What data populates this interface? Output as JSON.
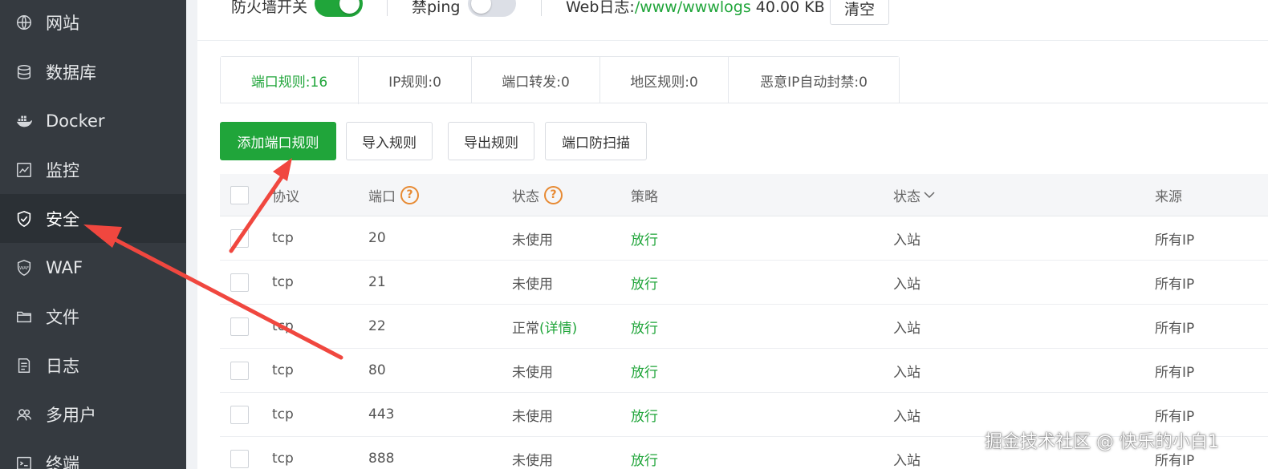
{
  "sidebar": {
    "items": [
      {
        "label": "网站",
        "icon": "globe-icon"
      },
      {
        "label": "数据库",
        "icon": "database-icon"
      },
      {
        "label": "Docker",
        "icon": "docker-icon"
      },
      {
        "label": "监控",
        "icon": "monitor-icon"
      },
      {
        "label": "安全",
        "icon": "shield-icon",
        "active": true
      },
      {
        "label": "WAF",
        "icon": "waf-shield-icon"
      },
      {
        "label": "文件",
        "icon": "folder-icon"
      },
      {
        "label": "日志",
        "icon": "log-icon"
      },
      {
        "label": "多用户",
        "icon": "users-icon"
      },
      {
        "label": "终端",
        "icon": "terminal-icon"
      }
    ]
  },
  "topbar": {
    "firewall_label": "防火墙开关",
    "firewall_on": true,
    "ping_label": "禁ping",
    "ping_on": false,
    "weblog_label": "Web日志:",
    "weblog_path": "/www/wwwlogs",
    "weblog_size": "40.00 KB",
    "clear_button": "清空"
  },
  "tabs": [
    {
      "label": "端口规则:16",
      "active": true
    },
    {
      "label": "IP规则:0"
    },
    {
      "label": "端口转发:0"
    },
    {
      "label": "地区规则:0"
    },
    {
      "label": "恶意IP自动封禁:0"
    }
  ],
  "actions": {
    "add": "添加端口规则",
    "import": "导入规则",
    "export": "导出规则",
    "scan": "端口防扫描"
  },
  "table": {
    "headers": {
      "protocol": "协议",
      "port": "端口",
      "status": "状态",
      "policy": "策略",
      "direction": "状态",
      "source": "来源"
    },
    "rows": [
      {
        "protocol": "tcp",
        "port": "20",
        "status": "未使用",
        "detail": "",
        "policy": "放行",
        "direction": "入站",
        "source": "所有IP"
      },
      {
        "protocol": "tcp",
        "port": "21",
        "status": "未使用",
        "detail": "",
        "policy": "放行",
        "direction": "入站",
        "source": "所有IP"
      },
      {
        "protocol": "tcp",
        "port": "22",
        "status": "正常",
        "detail": "(详情)",
        "policy": "放行",
        "direction": "入站",
        "source": "所有IP"
      },
      {
        "protocol": "tcp",
        "port": "80",
        "status": "未使用",
        "detail": "",
        "policy": "放行",
        "direction": "入站",
        "source": "所有IP"
      },
      {
        "protocol": "tcp",
        "port": "443",
        "status": "未使用",
        "detail": "",
        "policy": "放行",
        "direction": "入站",
        "source": "所有IP"
      },
      {
        "protocol": "tcp",
        "port": "888",
        "status": "未使用",
        "detail": "",
        "policy": "放行",
        "direction": "入站",
        "source": "所有IP"
      }
    ]
  },
  "watermark": "掘金技术社区 @ 快乐的小白1",
  "colors": {
    "accent": "#20a53a",
    "sidebar_bg": "#353a40",
    "annotation_arrow": "#f0473f"
  }
}
